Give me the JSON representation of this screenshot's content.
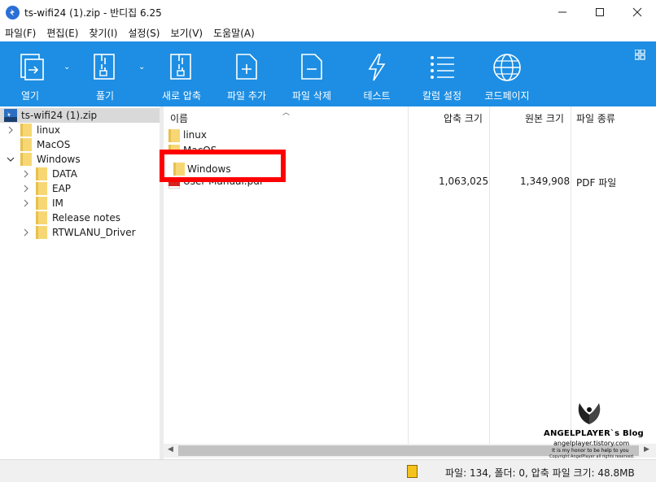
{
  "window": {
    "title": "ts-wifi24 (1).zip - 반디집 6.25"
  },
  "menu": [
    "파일(F)",
    "편집(E)",
    "찾기(I)",
    "설정(S)",
    "보기(V)",
    "도움말(A)"
  ],
  "toolbar": {
    "open_label": "열기",
    "extract_label": "풀기",
    "new_archive_label": "새로 압축",
    "add_file_label": "파일 추가",
    "delete_file_label": "파일 삭제",
    "test_label": "테스트",
    "columns_label": "칼럼 설정",
    "codepage_label": "코드페이지"
  },
  "tree": {
    "root": "ts-wifi24 (1).zip",
    "items": [
      {
        "label": "linux"
      },
      {
        "label": "MacOS"
      },
      {
        "label": "Windows"
      },
      {
        "label": "DATA"
      },
      {
        "label": "EAP"
      },
      {
        "label": "IM"
      },
      {
        "label": "Release notes"
      },
      {
        "label": "RTWLANU_Driver"
      }
    ]
  },
  "list": {
    "headers": {
      "name": "이름",
      "packed": "압축 크기",
      "original": "원본 크기",
      "type": "파일 종류"
    },
    "rows": [
      {
        "name": "linux",
        "packed": "",
        "original": "",
        "type": ""
      },
      {
        "name": "MacOS",
        "packed": "",
        "original": "",
        "type": ""
      },
      {
        "name": "Windows",
        "packed": "",
        "original": "",
        "type": ""
      },
      {
        "name": "User Manual.pdf",
        "packed": "1,063,025",
        "original": "1,349,908",
        "type": "PDF 파일"
      }
    ]
  },
  "status": {
    "text": "파일: 134, 폴더: 0, 압축 파일 크기: 48.8MB"
  },
  "watermark": {
    "title": "ANGELPLAYER`s Blog",
    "url": "angelplayer.tistory.com",
    "tagline": "It is my honor to be help to you",
    "copyright": "Copyright AngelPlayer all rights reserved."
  },
  "colors": {
    "toolbar_bg": "#1d8ee3",
    "highlight": "#ff0000",
    "folder": "#f7d774"
  }
}
